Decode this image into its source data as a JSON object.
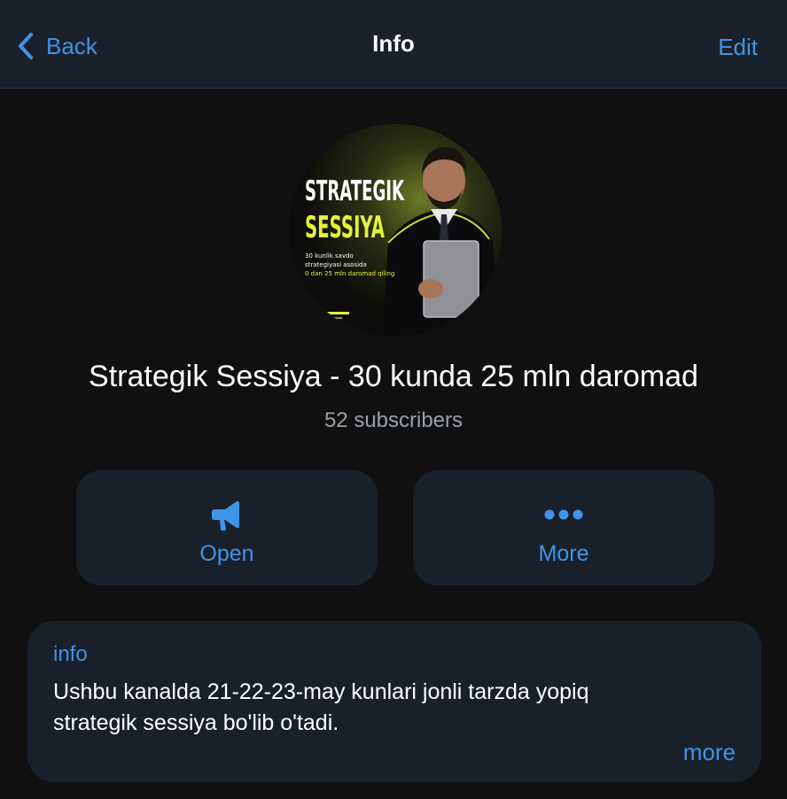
{
  "navbar": {
    "back_label": "Back",
    "title": "Info",
    "edit_label": "Edit"
  },
  "avatar": {
    "line1": "STRATEGIK",
    "line2": "SESSIYA",
    "small_line1": "30 kunlik savdo",
    "small_line2": "strategiyasi asosida",
    "small_line3": "0 dan 25 mln daromad qiling"
  },
  "channel": {
    "name": "Strategik Sessiya - 30 kunda 25 mln daromad",
    "subscribers": "52 subscribers"
  },
  "actions": {
    "open_label": "Open",
    "more_label": "More"
  },
  "info": {
    "heading": "info",
    "text_line1": "Ushbu kanalda 21-22-23-may kunlari jonli tarzda yopiq",
    "text_line2": "strategik sessiya bo'lib o'tadi.",
    "more_label": "more"
  },
  "colors": {
    "accent": "#3f95e8",
    "background": "#101010",
    "card": "#19202a",
    "navbar": "#1b212a",
    "avatar_highlight": "#e4f23a"
  }
}
